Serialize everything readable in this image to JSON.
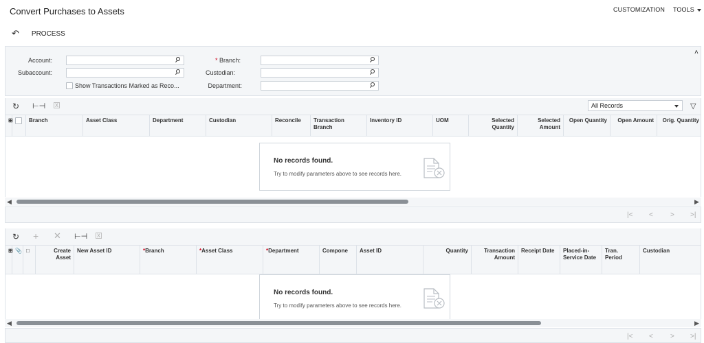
{
  "header": {
    "title": "Convert Purchases to Assets",
    "customization": "CUSTOMIZATION",
    "tools": "TOOLS"
  },
  "toolbar": {
    "process": "PROCESS"
  },
  "form": {
    "account_label": "Account:",
    "subaccount_label": "Subaccount:",
    "show_transactions_label": "Show Transactions Marked as Reco...",
    "branch_label": "Branch:",
    "custodian_label": "Custodian:",
    "department_label": "Department:"
  },
  "grid1": {
    "filter_value": "All Records",
    "columns": [
      {
        "label": "Branch"
      },
      {
        "label": "Asset Class"
      },
      {
        "label": "Department"
      },
      {
        "label": "Custodian"
      },
      {
        "label": "Reconcile"
      },
      {
        "label": "Transaction Branch"
      },
      {
        "label": "Inventory ID"
      },
      {
        "label": "UOM"
      },
      {
        "label": "Selected Quantity"
      },
      {
        "label": "Selected Amount"
      },
      {
        "label": "Open Quantity"
      },
      {
        "label": "Open Amount"
      },
      {
        "label": "Orig. Quantity"
      }
    ],
    "empty_title": "No records found.",
    "empty_subtitle": "Try to modify parameters above to see records here."
  },
  "grid2": {
    "columns": [
      {
        "label": "Create Asset"
      },
      {
        "label": "New Asset ID"
      },
      {
        "label": "Branch"
      },
      {
        "label": "Asset Class"
      },
      {
        "label": "Department"
      },
      {
        "label": "Compone"
      },
      {
        "label": "Asset ID"
      },
      {
        "label": "Quantity"
      },
      {
        "label": "Transaction Amount"
      },
      {
        "label": "Receipt Date"
      },
      {
        "label": "Placed-in-Service Date"
      },
      {
        "label": "Tran. Period"
      },
      {
        "label": "Custodian"
      }
    ],
    "empty_title": "No records found.",
    "empty_subtitle": "Try to modify parameters above to see records here."
  },
  "icons": {
    "undo": "undo-icon",
    "refresh": "refresh-icon",
    "fit": "fit-columns-icon",
    "export": "export-excel-icon",
    "filter": "filter-icon",
    "add": "add-icon",
    "delete": "delete-icon"
  },
  "colors": {
    "panel_bg": "#f4f6f8",
    "border": "#dde2e8",
    "required": "#d0021b"
  }
}
